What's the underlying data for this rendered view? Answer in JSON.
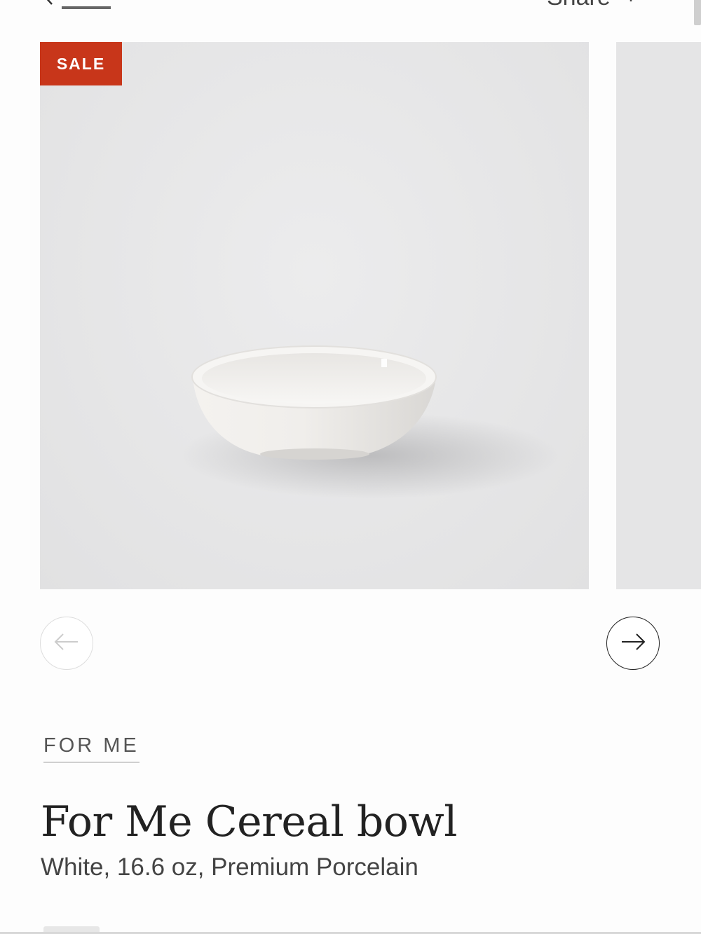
{
  "header": {
    "back_icon": "chevron-left-icon",
    "share_label": "Share",
    "share_icon": "share-icon"
  },
  "gallery": {
    "badge": "SALE",
    "badge_color": "#c8361a",
    "image_alt": "White porcelain cereal bowl",
    "prev_icon": "arrow-left-icon",
    "next_icon": "arrow-right-icon"
  },
  "product": {
    "brand": "FOR ME",
    "title": "For Me Cereal bowl",
    "subtitle": "White, 16.6 oz, Premium Porcelain"
  }
}
